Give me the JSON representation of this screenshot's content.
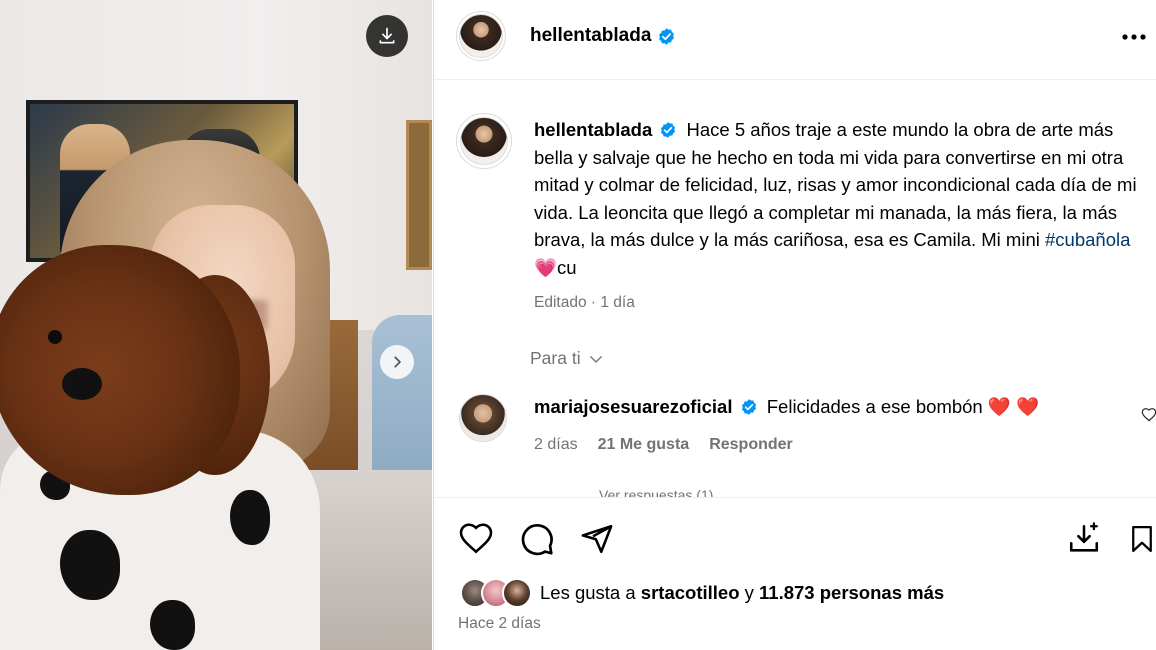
{
  "post": {
    "author": "hellentablada",
    "caption_text": "Hace 5 años traje a este mundo la obra de arte más bella y salvaje que he hecho en toda mi vida para convertirse en mi otra mitad y colmar de felicidad, luz, risas y amor incondicional cada día de mi vida. La leoncita que llegó a completar mi manada, la más fiera, la más brava, la más dulce y la más cariñosa, esa es Camila. Mi mini",
    "hashtag": "#cubañola",
    "caption_tail": "cu",
    "caption_emoji": "💗",
    "edited_label": "Editado · 1 día",
    "for_you_label": "Para ti",
    "more_icon": "more-horizontal-icon"
  },
  "comment": {
    "author": "mariajosesuarezoficial",
    "text": "Felicidades a ese bombón",
    "hearts": "❤️ ❤️",
    "time": "2 días",
    "likes": "21 Me gusta",
    "reply": "Responder",
    "view_replies": "Ver respuestas (1)"
  },
  "likes": {
    "prefix": "Les gusta a",
    "first_user": "srtacotilleo",
    "conjunction": "y",
    "others": "11.873 personas más"
  },
  "post_time": "Hace 2 días",
  "colors": {
    "verified": "#0095f6",
    "muted": "#737373",
    "hashtag": "#00376b",
    "heart": "#ed4956"
  }
}
